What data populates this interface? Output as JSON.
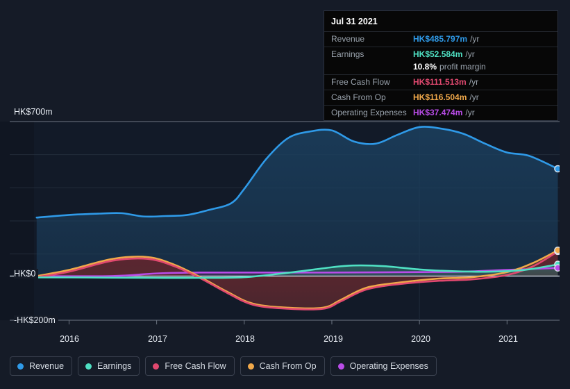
{
  "chart_data": {
    "type": "area",
    "title": "",
    "xlabel": "",
    "ylabel": "",
    "currency": "HK$",
    "grid": true,
    "legend_position": "bottom",
    "xlim": [
      2015.6,
      2021.6
    ],
    "ylim": [
      -200,
      700
    ],
    "x_ticks": [
      "2016",
      "2017",
      "2018",
      "2019",
      "2020",
      "2021"
    ],
    "x_tick_values": [
      2016,
      2017,
      2018,
      2019,
      2020,
      2021
    ],
    "y_ticks": [
      "HK$700m",
      "HK$0",
      "-HK$200m"
    ],
    "y_tick_values": [
      700,
      0,
      -200
    ],
    "gridline_values": [
      700,
      550,
      400,
      250,
      100,
      0,
      -200
    ],
    "series": [
      {
        "name": "Revenue",
        "color": "#2f9ae8",
        "fill": "#1b3f5e",
        "x": [
          2015.63,
          2016.0,
          2016.35,
          2016.6,
          2016.85,
          2017.1,
          2017.35,
          2017.6,
          2017.85,
          2018.0,
          2018.25,
          2018.5,
          2018.75,
          2019.0,
          2019.25,
          2019.5,
          2019.75,
          2020.0,
          2020.25,
          2020.5,
          2020.75,
          2021.0,
          2021.25,
          2021.58
        ],
        "values": [
          265,
          277,
          283,
          285,
          270,
          272,
          277,
          300,
          330,
          395,
          530,
          625,
          655,
          660,
          610,
          600,
          640,
          675,
          668,
          645,
          600,
          560,
          545,
          486
        ],
        "end_value": 485.797,
        "end_label": "HK$485.797m"
      },
      {
        "name": "Earnings",
        "color": "#4fe0c3",
        "fill": "#2f5f5e",
        "x": [
          2015.63,
          2016.0,
          2016.5,
          2017.0,
          2017.5,
          2018.0,
          2018.5,
          2019.0,
          2019.25,
          2019.6,
          2020.0,
          2020.4,
          2020.8,
          2021.2,
          2021.58
        ],
        "values": [
          -6,
          -6,
          -7,
          -8,
          -8,
          -5,
          15,
          40,
          48,
          45,
          30,
          22,
          20,
          28,
          53
        ],
        "end_value": 52.584,
        "end_label": "HK$52.584m"
      },
      {
        "name": "Free Cash Flow",
        "color": "#e0486f",
        "fill": "#5c2230",
        "x": [
          2015.63,
          2016.0,
          2016.5,
          2016.9,
          2017.2,
          2017.5,
          2017.8,
          2018.1,
          2018.5,
          2018.9,
          2019.1,
          2019.4,
          2019.8,
          2020.2,
          2020.6,
          2021.0,
          2021.3,
          2021.58
        ],
        "values": [
          -5,
          20,
          70,
          78,
          45,
          -10,
          -75,
          -130,
          -148,
          -148,
          -115,
          -60,
          -35,
          -22,
          -15,
          5,
          45,
          112
        ],
        "end_value": 111.513,
        "end_label": "HK$111.513m"
      },
      {
        "name": "Cash From Op",
        "color": "#f0a84a",
        "fill": "#5c3a2c",
        "x": [
          2015.63,
          2016.0,
          2016.5,
          2016.9,
          2017.2,
          2017.5,
          2017.8,
          2018.1,
          2018.5,
          2018.9,
          2019.1,
          2019.4,
          2019.8,
          2020.2,
          2020.6,
          2021.0,
          2021.3,
          2021.58
        ],
        "values": [
          0,
          28,
          78,
          86,
          52,
          -5,
          -70,
          -125,
          -143,
          -143,
          -108,
          -52,
          -28,
          -12,
          -5,
          18,
          60,
          117
        ],
        "end_value": 116.504,
        "end_label": "HK$116.504m"
      },
      {
        "name": "Operating Expenses",
        "color": "#b94ce8",
        "fill": "#4a3360",
        "x": [
          2015.63,
          2016.5,
          2017.0,
          2017.5,
          2018.0,
          2018.5,
          2019.0,
          2019.5,
          2020.0,
          2020.5,
          2021.0,
          2021.58
        ],
        "values": [
          0,
          0,
          12,
          16,
          16,
          16,
          16,
          17,
          18,
          20,
          28,
          37
        ],
        "end_value": 37.474,
        "end_label": "HK$37.474m"
      }
    ]
  },
  "tooltip": {
    "date": "Jul 31 2021",
    "rows": [
      {
        "label": "Revenue",
        "value": "HK$485.797m",
        "unit": "/yr",
        "color": "#2f9ae8"
      },
      {
        "label": "Earnings",
        "value": "HK$52.584m",
        "unit": "/yr",
        "color": "#4fe0c3"
      },
      {
        "label": "Free Cash Flow",
        "value": "HK$111.513m",
        "unit": "/yr",
        "color": "#e0486f"
      },
      {
        "label": "Cash From Op",
        "value": "HK$116.504m",
        "unit": "/yr",
        "color": "#f0a84a"
      },
      {
        "label": "Operating Expenses",
        "value": "HK$37.474m",
        "unit": "/yr",
        "color": "#b94ce8"
      }
    ],
    "margin_value": "10.8%",
    "margin_label": "profit margin"
  },
  "legend": {
    "items": [
      {
        "label": "Revenue",
        "color": "#2f9ae8"
      },
      {
        "label": "Earnings",
        "color": "#4fe0c3"
      },
      {
        "label": "Free Cash Flow",
        "color": "#e0486f"
      },
      {
        "label": "Cash From Op",
        "color": "#f0a84a"
      },
      {
        "label": "Operating Expenses",
        "color": "#b94ce8"
      }
    ]
  },
  "axes": {
    "y_top_label": "HK$700m",
    "y_zero_label": "HK$0",
    "y_bottom_label": "-HK$200m",
    "x_labels": [
      "2016",
      "2017",
      "2018",
      "2019",
      "2020",
      "2021"
    ]
  }
}
